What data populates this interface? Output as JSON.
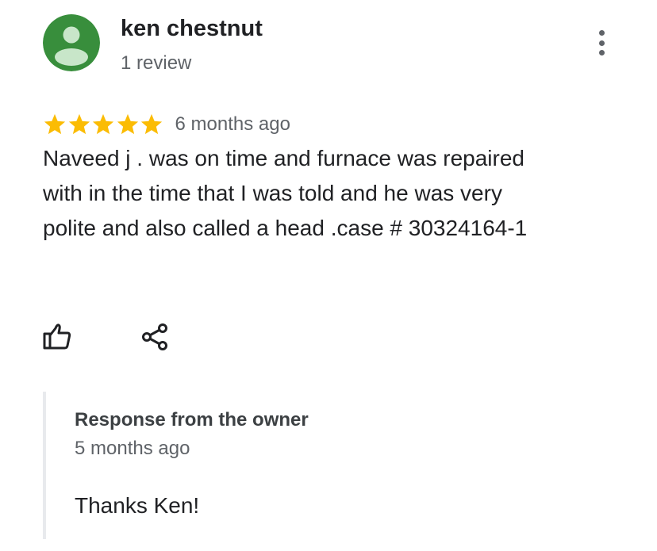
{
  "review": {
    "reviewer_name": "ken chestnut",
    "review_count": "1 review",
    "rating": 5,
    "max_rating": 5,
    "date": "6 months ago",
    "text": "Naveed j . was on time and furnace was repaired with in the time that I was told and he was very polite and also called a head .case # 30324164-1"
  },
  "actions": {
    "like_icon": "thumbs-up-icon",
    "share_icon": "share-icon",
    "more_icon": "more-vert-icon"
  },
  "owner_response": {
    "title": "Response from the owner",
    "date": "5 months ago",
    "text": "Thanks Ken!"
  },
  "colors": {
    "star": "#fbbc04",
    "avatar_bg": "#388e3c",
    "avatar_fg": "#c8e6c9",
    "secondary_text": "#5f6368",
    "response_border": "#e8eaed"
  }
}
